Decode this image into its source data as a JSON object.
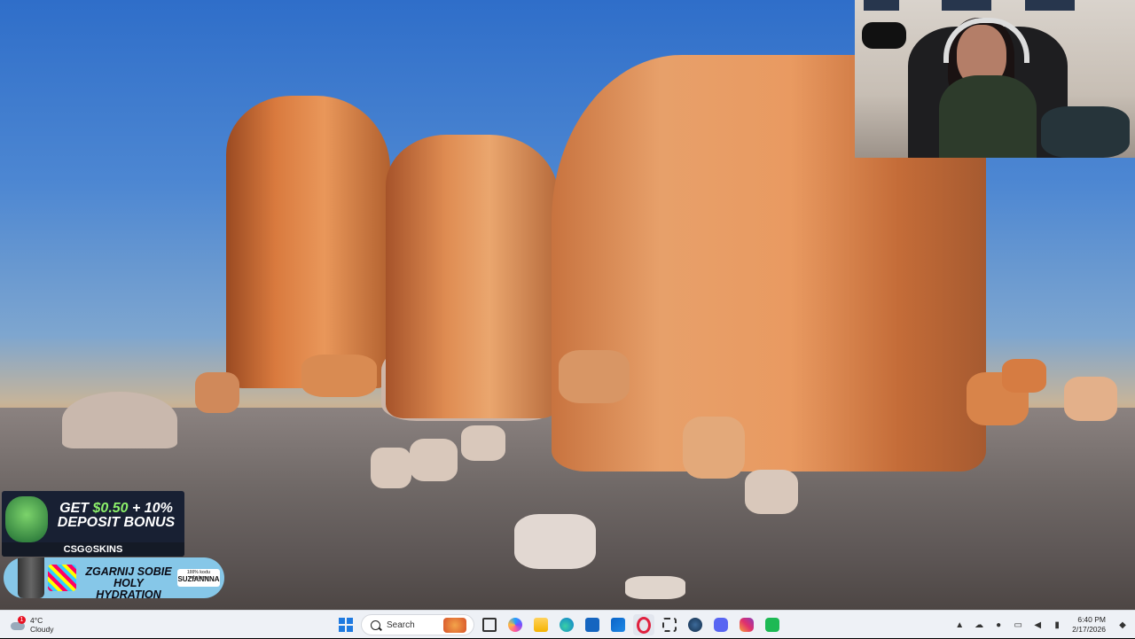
{
  "ads": {
    "deposit": {
      "line1_prefix": "GET ",
      "amount": "$0.50",
      "line1_suffix": " + 10%",
      "line2": "DEPOSIT BONUS",
      "brand": "CSG⊙SKINS"
    },
    "hydration": {
      "line1": "ZGARNIJ SOBIE",
      "line2": "HOLY HYDRATION",
      "brand_small": "100% kodu rabatowy",
      "brand": "SUZIANNNA"
    }
  },
  "taskbar": {
    "weather": {
      "temp": "4°C",
      "condition": "Cloudy",
      "badge": "1"
    },
    "search": {
      "placeholder": "Search"
    },
    "clock": {
      "time": "6:40 PM",
      "date": "2/17/2026"
    },
    "pinned_icons": [
      "windows-start-icon",
      "search-box",
      "task-view-icon",
      "copilot-icon",
      "file-explorer-icon",
      "edge-icon",
      "microsoft-store-icon",
      "outlook-icon",
      "opera-gx-icon",
      "snipping-tool-icon",
      "steam-icon",
      "discord-icon",
      "instagram-icon",
      "app-icon"
    ],
    "tray_icons": [
      "chevron-up-icon",
      "cloud-icon",
      "microphone-icon",
      "network-icon",
      "volume-icon",
      "battery-icon"
    ]
  }
}
